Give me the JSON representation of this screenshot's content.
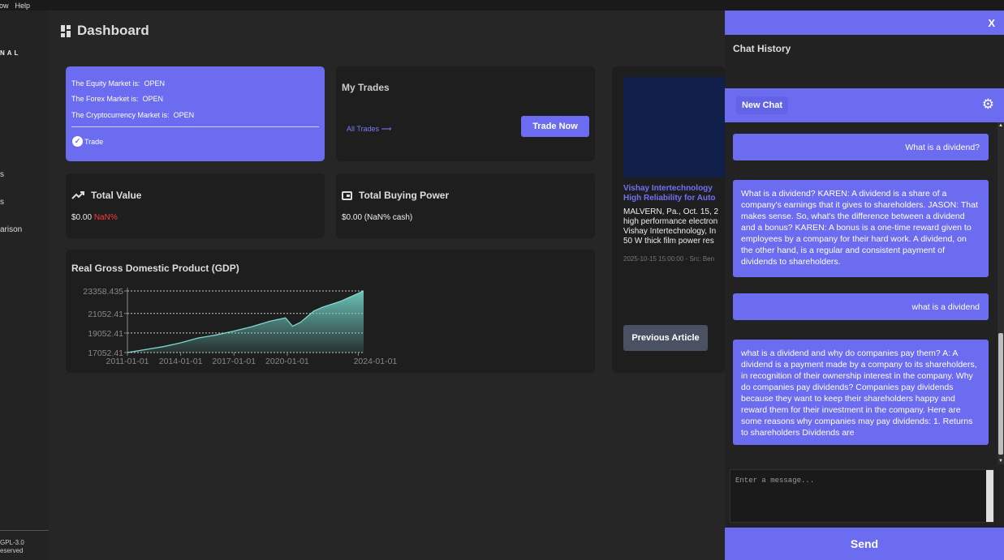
{
  "menubar": {
    "items": [
      "dow",
      "Help"
    ]
  },
  "sidebar": {
    "brand": "NAL",
    "nav": [
      "s",
      "s",
      "arison"
    ],
    "footer": [
      "GPL-3.0",
      "eserved"
    ]
  },
  "dashboard": {
    "title": "Dashboard"
  },
  "market": {
    "equity_label": "The Equity Market is:",
    "equity_status": "OPEN",
    "forex_label": "The Forex Market is:",
    "forex_status": "OPEN",
    "crypto_label": "The Cryptocurrency Market is:",
    "crypto_status": "OPEN",
    "trade_label": "Trade"
  },
  "trades": {
    "title": "My Trades",
    "all_link": "All Trades ⟶",
    "trade_now": "Trade Now"
  },
  "total_value": {
    "title": "Total Value",
    "amount": "$0.00",
    "change": "NaN%"
  },
  "buying_power": {
    "title": "Total Buying Power",
    "amount": "$0.00 (NaN% cash)"
  },
  "chart_data": {
    "type": "area",
    "title": "Real Gross Domestic Product (GDP)",
    "x_ticks": [
      "2011-01-01",
      "2014-01-01",
      "2017-01-01",
      "2020-01-01",
      "2024-01-01"
    ],
    "y_ticks": [
      "23358.435",
      "21052.41",
      "19052.41",
      "17052.41"
    ],
    "ylim": [
      17052.41,
      23358.435
    ],
    "grid": true,
    "x": [
      2011,
      2012,
      2013,
      2014,
      2015,
      2016,
      2017,
      2018,
      2019,
      2019.9,
      2020.3,
      2020.75,
      2021.5,
      2022,
      2023,
      2024.3
    ],
    "values": [
      17052.41,
      17350,
      17650,
      18050,
      18550,
      18850,
      19250,
      19700,
      20250,
      20600,
      19750,
      20150,
      21300,
      21700,
      22300,
      23358.435
    ]
  },
  "news": {
    "headline": [
      "Vishay Intertechnology",
      "High Reliability for Auto"
    ],
    "body": [
      "MALVERN, Pa., Oct. 15, 2",
      "high performance electron",
      "Vishay Intertechnology, In",
      "50 W thick film power res"
    ],
    "source": "2025-10-15 15:00:00 - Src: Ben",
    "prev_button": "Previous Article"
  },
  "chat": {
    "close": "X",
    "history_title": "Chat History",
    "new_chat": "New Chat",
    "messages": [
      {
        "role": "user",
        "text": "What is a dividend?"
      },
      {
        "role": "bot",
        "text": "What is a dividend? KAREN: A dividend is a share of a company's earnings that it gives to shareholders. JASON: That makes sense. So, what's the difference between a dividend and a bonus? KAREN: A bonus is a one-time reward given to employees by a company for their hard work. A dividend, on the other hand, is a regular and consistent payment of dividends to shareholders."
      },
      {
        "role": "user",
        "text": "what is a dividend"
      },
      {
        "role": "bot",
        "text": "what is a dividend and why do companies pay them? A: A dividend is a payment made by a company to its shareholders, in recognition of their ownership interest in the company. Why do companies pay dividends? Companies pay dividends because they want to keep their shareholders happy and reward them for their investment in the company. Here are some reasons why companies may pay dividends: 1. Returns to shareholders Dividends are"
      }
    ],
    "input_placeholder": "Enter a message...",
    "send": "Send"
  },
  "colors": {
    "accent": "#6b6cf0",
    "negative": "#ff3b3b",
    "chart_line": "#6fc9c0"
  }
}
